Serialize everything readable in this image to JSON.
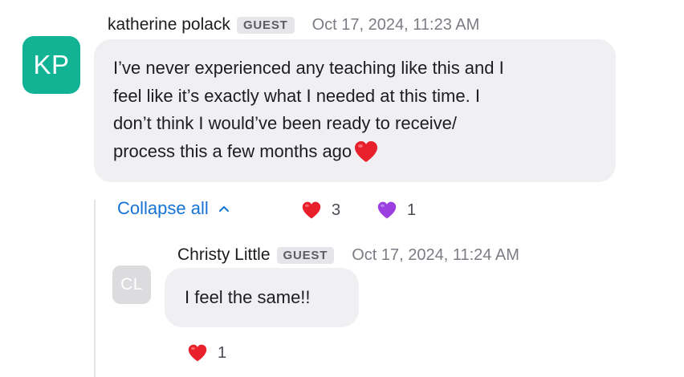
{
  "messages": [
    {
      "avatar_initials": "KP",
      "author": "katherine polack",
      "badge": "GUEST",
      "timestamp": "Oct 17, 2024, 11:23 AM",
      "lines": [
        "I’ve never experienced any teaching like this and I",
        "feel like it’s exactly what I needed at this time. I",
        "don’t think I would’ve been ready to receive/",
        "process this a few months ago"
      ],
      "inline_emoji": "red-heart-emoji",
      "reactions": [
        {
          "icon": "red-heart-emoji",
          "color": "#e8202b",
          "count": "3"
        },
        {
          "icon": "purple-heart-emoji",
          "color": "#9b3fe0",
          "count": "1"
        }
      ]
    }
  ],
  "thread": {
    "collapse_label": "Collapse all",
    "collapse_icon": "chevron-up-icon",
    "accent_color": "#1573d6",
    "replies": [
      {
        "avatar_initials": "CL",
        "author": "Christy Little",
        "badge": "GUEST",
        "timestamp": "Oct 17, 2024, 11:24 AM",
        "text": "I feel the same!!",
        "reactions": [
          {
            "icon": "red-heart-emoji",
            "color": "#e8202b",
            "count": "1"
          }
        ]
      }
    ]
  },
  "colors": {
    "avatar_kp": "#12b395",
    "avatar_cl": "#dcdcde",
    "bubble": "#f0f0f3",
    "badge_bg": "#e6e6ea"
  }
}
